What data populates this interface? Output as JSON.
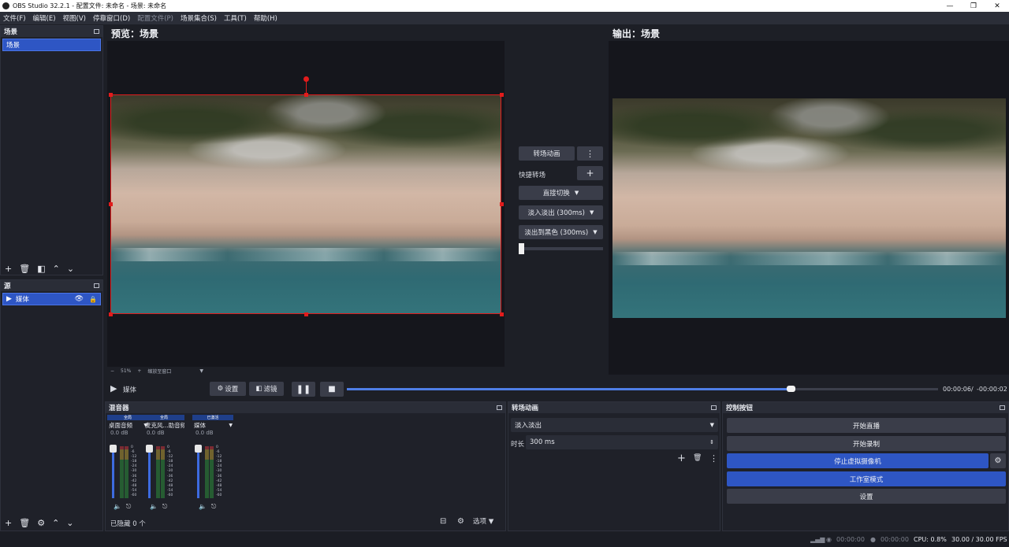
{
  "window": {
    "title": "OBS Studio 32.2.1 - 配置文件: 未命名 - 场景: 未命名",
    "minimize": "—",
    "maximize": "❐",
    "close": "✕"
  },
  "menu": [
    {
      "label": "文件(F)",
      "disabled": false
    },
    {
      "label": "编辑(E)",
      "disabled": false
    },
    {
      "label": "视图(V)",
      "disabled": false
    },
    {
      "label": "停靠窗口(D)",
      "disabled": false
    },
    {
      "label": "配置文件(P)",
      "disabled": true
    },
    {
      "label": "场景集合(S)",
      "disabled": false
    },
    {
      "label": "工具(T)",
      "disabled": false
    },
    {
      "label": "帮助(H)",
      "disabled": false
    }
  ],
  "scenes": {
    "title": "场景",
    "items": [
      "场景"
    ]
  },
  "sources": {
    "title": "源",
    "items": [
      {
        "name": "媒体",
        "visible_icon": "eye-icon",
        "lock_icon": "lock-icon"
      }
    ]
  },
  "preview": {
    "title": "预览：场景",
    "zoom": "51%",
    "zoom_mode": "缩放至窗口"
  },
  "program": {
    "title": "输出：场景"
  },
  "transition_column": {
    "transition_button": "转场动画",
    "quick_transitions": "快捷转场",
    "cut": "直接切换",
    "fade": "淡入淡出 (300ms)",
    "fade_to_black": "淡出到黑色 (300ms)"
  },
  "media_controls": {
    "source_name": "媒体",
    "settings": "设置",
    "filters": "滤镜",
    "elapsed": "00:00:06",
    "separator": "/",
    "remaining": "-00:00:02",
    "progress": 0.75
  },
  "mixer": {
    "title": "混音器",
    "strips": [
      {
        "scope": "全局",
        "name": "桌面音频",
        "db": "0.0 dB"
      },
      {
        "scope": "全局",
        "name": "麦克风...助音频",
        "db": "0.0 dB"
      },
      {
        "scope": "已激活",
        "name": "媒体",
        "db": "0.0 dB"
      }
    ],
    "ticks": [
      "0",
      "-6",
      "-12",
      "-18",
      "-24",
      "-30",
      "-36",
      "-42",
      "-48",
      "-54",
      "-60"
    ],
    "hidden": "已隐藏 0 个",
    "options": "选项"
  },
  "transitions_dock": {
    "title": "转场动画",
    "selected": "淡入淡出",
    "duration_label": "时长",
    "duration_value": "300 ms"
  },
  "controls": {
    "title": "控制按钮",
    "start_stream": "开始直播",
    "start_record": "开始录制",
    "stop_virtualcam": "停止虚拟摄像机",
    "studio_mode": "工作室模式",
    "settings": "设置"
  },
  "status": {
    "stream_time": "00:00:00",
    "record_time": "00:00:00",
    "cpu": "CPU: 0.8%",
    "fps": "30.00 / 30.00 FPS"
  },
  "colors": {
    "accent": "#2e56c4",
    "selection": "#e21c1c",
    "panel": "#1f2129"
  }
}
